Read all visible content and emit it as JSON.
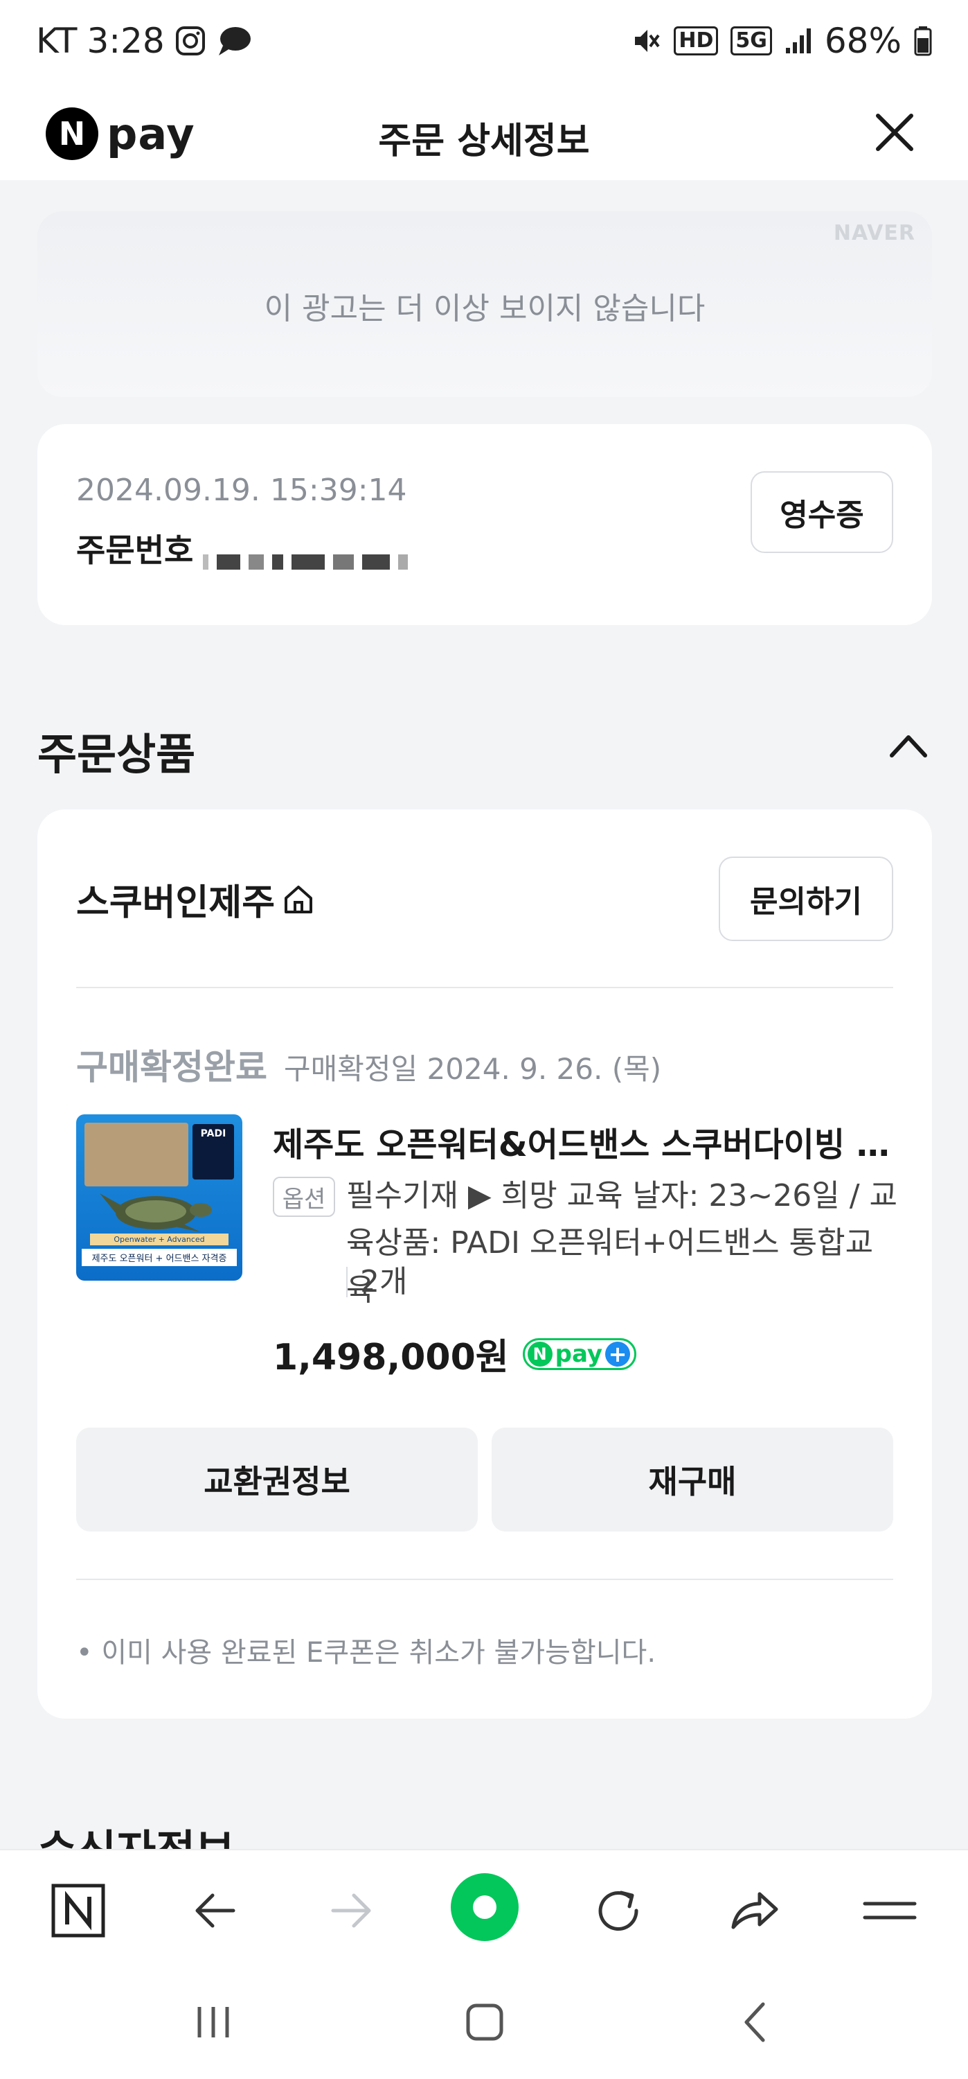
{
  "status_bar": {
    "carrier": "KT",
    "time": "3:28",
    "network": "5G",
    "hd": "HD",
    "battery": "68%"
  },
  "header": {
    "logo_text": "pay",
    "logo_badge": "N",
    "title": "주문 상세정보"
  },
  "ad": {
    "brand": "NAVER",
    "message": "이 광고는 더 이상 보이지 않습니다"
  },
  "order": {
    "datetime": "2024.09.19. 15:39:14",
    "number_label": "주문번호",
    "receipt_label": "영수증"
  },
  "section": {
    "title": "주문상품",
    "next_title_peek": "수신자정보"
  },
  "product_card": {
    "store_name": "스쿠버인제주",
    "inquiry_label": "문의하기",
    "status": "구매확정완료",
    "status_date": "구매확정일 2024. 9. 26. (목)",
    "product_name": "제주도 오픈워터&어드밴스 스쿠버다이빙 자격증",
    "option_badge": "옵션",
    "option_text": "필수기재 ▶ 희망 교육 날자: 23~26일 / 교육상품: PADI 오픈워터+어드밴스 통합교육",
    "quantity": "2개",
    "price": "1,498,000원",
    "npay_plus_label": "pay",
    "thumb_caption": "제주도 오픈워터 + 어드밴스 자격증",
    "thumb_subcaption": "Openwater + Advanced",
    "thumb_logo": "PADI",
    "buttons": {
      "exchange": "교환권정보",
      "rebuy": "재구매"
    },
    "notice": "이미 사용 완료된 E쿠폰은 취소가 불가능합니다."
  },
  "toolbar": {
    "home_badge": "N"
  },
  "colors": {
    "npay_green": "#03c75a",
    "page_bg": "#f3f4f6",
    "muted_text": "#8a8f97"
  }
}
